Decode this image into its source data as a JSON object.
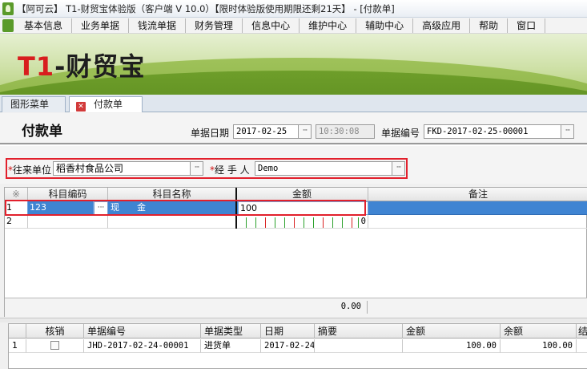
{
  "window": {
    "title": "【阿可云】 T1-财贸宝体验版（客户端 V 10.0）【限时体验版使用期限还剩21天】 - [付款单]"
  },
  "menu": [
    "基本信息",
    "业务单据",
    "钱流单据",
    "财务管理",
    "信息中心",
    "维护中心",
    "辅助中心",
    "高级应用",
    "帮助",
    "窗口"
  ],
  "banner": {
    "logo_t1": "T1",
    "logo_rest": "-财贸宝"
  },
  "tabs": [
    {
      "label": "图形菜单"
    },
    {
      "label": "付款单"
    }
  ],
  "form": {
    "heading": "付款单",
    "date_label": "单据日期",
    "date_value": "2017-02-25",
    "time_value": "10:30:08",
    "docno_label": "单据编号",
    "docno_value": "FKD-2017-02-25-00001",
    "partner_req": "*",
    "partner_label": "往来单位",
    "partner_value": "稻香村食品公司",
    "handler_req": "*",
    "handler_label": "经 手 人",
    "handler_value": "Demo",
    "dots": "···"
  },
  "grid": {
    "corner": "※",
    "columns": [
      "科目编码",
      "科目名称",
      "金额",
      "备注"
    ],
    "rows": [
      {
        "num": "1",
        "code": "123",
        "name": "现　　金",
        "amount": "100",
        "note": ""
      },
      {
        "num": "2",
        "code": "",
        "name": "",
        "amount": "0",
        "note": ""
      }
    ],
    "total": "0.00"
  },
  "bottom": {
    "columns": [
      "核销",
      "单据编号",
      "单据类型",
      "日期",
      "摘要",
      "金额",
      "余额",
      "结"
    ],
    "rows": [
      {
        "num": "1",
        "docno": "JHD-2017-02-24-00001",
        "type": "进货单",
        "date": "2017-02-24",
        "summary": "",
        "amount": "100.00",
        "balance": "100.00"
      }
    ]
  }
}
